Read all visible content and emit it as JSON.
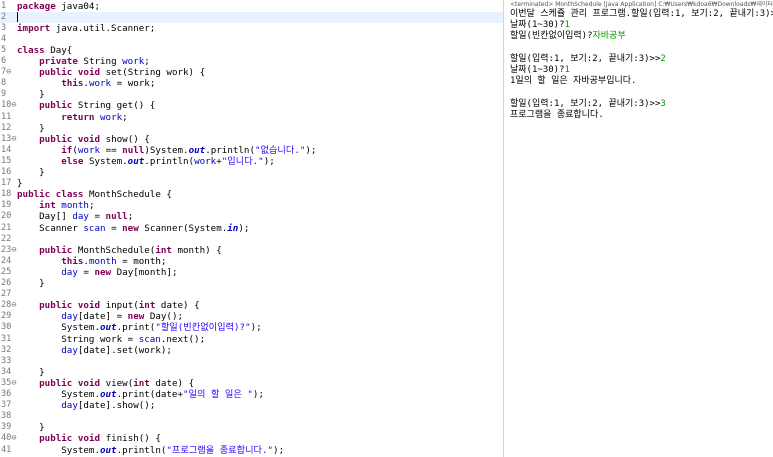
{
  "editor": {
    "lines": [
      {
        "n": "1",
        "segs": [
          {
            "t": "package",
            "c": "kw"
          },
          {
            "t": " java04;"
          }
        ]
      },
      {
        "n": "2",
        "segs": [],
        "current": true
      },
      {
        "n": "3",
        "segs": [
          {
            "t": "import",
            "c": "kw"
          },
          {
            "t": " java.util.Scanner;"
          }
        ]
      },
      {
        "n": "4",
        "segs": []
      },
      {
        "n": "5",
        "segs": [
          {
            "t": "class",
            "c": "kw"
          },
          {
            "t": " Day{"
          }
        ]
      },
      {
        "n": "6",
        "segs": [
          {
            "t": "    "
          },
          {
            "t": "private",
            "c": "kw"
          },
          {
            "t": " String "
          },
          {
            "t": "work",
            "c": "fld"
          },
          {
            "t": ";"
          }
        ]
      },
      {
        "n": "7⊖",
        "segs": [
          {
            "t": "    "
          },
          {
            "t": "public",
            "c": "kw"
          },
          {
            "t": " "
          },
          {
            "t": "void",
            "c": "kw"
          },
          {
            "t": " set(String work) {"
          }
        ]
      },
      {
        "n": "8",
        "segs": [
          {
            "t": "        "
          },
          {
            "t": "this",
            "c": "kw"
          },
          {
            "t": "."
          },
          {
            "t": "work",
            "c": "fld"
          },
          {
            "t": " = work;"
          }
        ]
      },
      {
        "n": "9",
        "segs": [
          {
            "t": "    }"
          }
        ]
      },
      {
        "n": "10⊖",
        "segs": [
          {
            "t": "    "
          },
          {
            "t": "public",
            "c": "kw"
          },
          {
            "t": " String get() {"
          }
        ]
      },
      {
        "n": "11",
        "segs": [
          {
            "t": "        "
          },
          {
            "t": "return",
            "c": "kw"
          },
          {
            "t": " "
          },
          {
            "t": "work",
            "c": "fld"
          },
          {
            "t": ";"
          }
        ]
      },
      {
        "n": "12",
        "segs": [
          {
            "t": "    }"
          }
        ]
      },
      {
        "n": "13⊖",
        "segs": [
          {
            "t": "    "
          },
          {
            "t": "public",
            "c": "kw"
          },
          {
            "t": " "
          },
          {
            "t": "void",
            "c": "kw"
          },
          {
            "t": " show() {"
          }
        ]
      },
      {
        "n": "14",
        "segs": [
          {
            "t": "        "
          },
          {
            "t": "if",
            "c": "kw"
          },
          {
            "t": "("
          },
          {
            "t": "work",
            "c": "fld"
          },
          {
            "t": " == "
          },
          {
            "t": "null",
            "c": "kw"
          },
          {
            "t": ")System."
          },
          {
            "t": "out",
            "c": "sf"
          },
          {
            "t": ".println("
          },
          {
            "t": "\"없습니다.\"",
            "c": "str"
          },
          {
            "t": ");"
          }
        ]
      },
      {
        "n": "15",
        "segs": [
          {
            "t": "        "
          },
          {
            "t": "else",
            "c": "kw"
          },
          {
            "t": " System."
          },
          {
            "t": "out",
            "c": "sf"
          },
          {
            "t": ".println("
          },
          {
            "t": "work",
            "c": "fld"
          },
          {
            "t": "+"
          },
          {
            "t": "\"입니다.\"",
            "c": "str"
          },
          {
            "t": ");"
          }
        ]
      },
      {
        "n": "16",
        "segs": [
          {
            "t": "    }"
          }
        ]
      },
      {
        "n": "17",
        "segs": [
          {
            "t": "}"
          }
        ]
      },
      {
        "n": "18",
        "segs": [
          {
            "t": "public",
            "c": "kw"
          },
          {
            "t": " "
          },
          {
            "t": "class",
            "c": "kw"
          },
          {
            "t": " MonthSchedule {"
          }
        ]
      },
      {
        "n": "19",
        "segs": [
          {
            "t": "    "
          },
          {
            "t": "int",
            "c": "kw"
          },
          {
            "t": " "
          },
          {
            "t": "month",
            "c": "fld"
          },
          {
            "t": ";"
          }
        ]
      },
      {
        "n": "20",
        "segs": [
          {
            "t": "    Day[] "
          },
          {
            "t": "day",
            "c": "fld"
          },
          {
            "t": " = "
          },
          {
            "t": "null",
            "c": "kw"
          },
          {
            "t": ";"
          }
        ]
      },
      {
        "n": "21",
        "segs": [
          {
            "t": "    Scanner "
          },
          {
            "t": "scan",
            "c": "fld"
          },
          {
            "t": " = "
          },
          {
            "t": "new",
            "c": "kw"
          },
          {
            "t": " Scanner(System."
          },
          {
            "t": "in",
            "c": "sf"
          },
          {
            "t": ");"
          }
        ]
      },
      {
        "n": "22",
        "segs": []
      },
      {
        "n": "23⊖",
        "segs": [
          {
            "t": "    "
          },
          {
            "t": "public",
            "c": "kw"
          },
          {
            "t": " MonthSchedule("
          },
          {
            "t": "int",
            "c": "kw"
          },
          {
            "t": " month) {"
          }
        ]
      },
      {
        "n": "24",
        "segs": [
          {
            "t": "        "
          },
          {
            "t": "this",
            "c": "kw"
          },
          {
            "t": "."
          },
          {
            "t": "month",
            "c": "fld"
          },
          {
            "t": " = month;"
          }
        ]
      },
      {
        "n": "25",
        "segs": [
          {
            "t": "        "
          },
          {
            "t": "day",
            "c": "fld"
          },
          {
            "t": " = "
          },
          {
            "t": "new",
            "c": "kw"
          },
          {
            "t": " Day[month];"
          }
        ]
      },
      {
        "n": "26",
        "segs": [
          {
            "t": "    }"
          }
        ]
      },
      {
        "n": "27",
        "segs": []
      },
      {
        "n": "28⊖",
        "segs": [
          {
            "t": "    "
          },
          {
            "t": "public",
            "c": "kw"
          },
          {
            "t": " "
          },
          {
            "t": "void",
            "c": "kw"
          },
          {
            "t": " input("
          },
          {
            "t": "int",
            "c": "kw"
          },
          {
            "t": " date) {"
          }
        ]
      },
      {
        "n": "29",
        "segs": [
          {
            "t": "        "
          },
          {
            "t": "day",
            "c": "fld"
          },
          {
            "t": "[date] = "
          },
          {
            "t": "new",
            "c": "kw"
          },
          {
            "t": " Day();"
          }
        ]
      },
      {
        "n": "30",
        "segs": [
          {
            "t": "        System."
          },
          {
            "t": "out",
            "c": "sf"
          },
          {
            "t": ".print("
          },
          {
            "t": "\"할일(빈칸없이입력)?\"",
            "c": "str"
          },
          {
            "t": ");"
          }
        ]
      },
      {
        "n": "31",
        "segs": [
          {
            "t": "        String work = "
          },
          {
            "t": "scan",
            "c": "fld"
          },
          {
            "t": ".next();"
          }
        ]
      },
      {
        "n": "32",
        "segs": [
          {
            "t": "        "
          },
          {
            "t": "day",
            "c": "fld"
          },
          {
            "t": "[date].set(work);"
          }
        ]
      },
      {
        "n": "33",
        "segs": []
      },
      {
        "n": "34",
        "segs": [
          {
            "t": "    }"
          }
        ]
      },
      {
        "n": "35⊖",
        "segs": [
          {
            "t": "    "
          },
          {
            "t": "public",
            "c": "kw"
          },
          {
            "t": " "
          },
          {
            "t": "void",
            "c": "kw"
          },
          {
            "t": " view("
          },
          {
            "t": "int",
            "c": "kw"
          },
          {
            "t": " date) {"
          }
        ]
      },
      {
        "n": "36",
        "segs": [
          {
            "t": "        System."
          },
          {
            "t": "out",
            "c": "sf"
          },
          {
            "t": ".print(date+"
          },
          {
            "t": "\"일의 할 일은 \"",
            "c": "str"
          },
          {
            "t": ");"
          }
        ]
      },
      {
        "n": "37",
        "segs": [
          {
            "t": "        "
          },
          {
            "t": "day",
            "c": "fld"
          },
          {
            "t": "[date].show();"
          }
        ]
      },
      {
        "n": "38",
        "segs": []
      },
      {
        "n": "39",
        "segs": [
          {
            "t": "    }"
          }
        ]
      },
      {
        "n": "40⊖",
        "segs": [
          {
            "t": "    "
          },
          {
            "t": "public",
            "c": "kw"
          },
          {
            "t": " "
          },
          {
            "t": "void",
            "c": "kw"
          },
          {
            "t": " finish() {"
          }
        ]
      },
      {
        "n": "41",
        "segs": [
          {
            "t": "        System."
          },
          {
            "t": "out",
            "c": "sf"
          },
          {
            "t": ".println("
          },
          {
            "t": "\"프로그램을 종료합니다.\"",
            "c": "str"
          },
          {
            "t": ");"
          }
        ]
      }
    ]
  },
  "console": {
    "header": "<terminated> MonthSchedule [Java Application] C:₩Users₩kdoa6₩Downloads₩데이터베이스_...",
    "lines": [
      [
        {
          "t": "이번달 스케쥴 관리 프로그램.할일(입력:1, 보기:2, 끝내기:3)>>"
        },
        {
          "t": "1",
          "c": "in"
        }
      ],
      [
        {
          "t": "날짜(1~30)?"
        },
        {
          "t": "1",
          "c": "in"
        }
      ],
      [
        {
          "t": "할일(빈칸없이입력)?"
        },
        {
          "t": "자바공부",
          "c": "in"
        }
      ],
      [],
      [
        {
          "t": "할일(입력:1, 보기:2, 끝내기:3)>>"
        },
        {
          "t": "2",
          "c": "in"
        }
      ],
      [
        {
          "t": "날짜(1~30)?"
        },
        {
          "t": "1",
          "c": "in"
        }
      ],
      [
        {
          "t": "1일의 할 일은 자바공부입니다."
        }
      ],
      [],
      [
        {
          "t": "할일(입력:1, 보기:2, 끝내기:3)>>"
        },
        {
          "t": "3",
          "c": "in"
        }
      ],
      [
        {
          "t": "프로그램을 종료합니다."
        }
      ]
    ]
  }
}
